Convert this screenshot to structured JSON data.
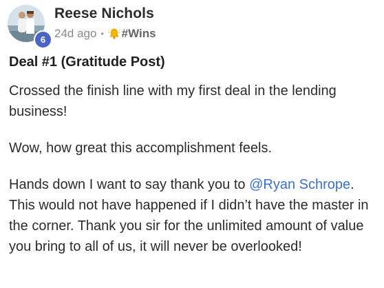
{
  "post": {
    "author": {
      "name": "Reese Nichols",
      "level": "6"
    },
    "time_ago": "24d ago",
    "separator": "•",
    "category": "#Wins",
    "title": "Deal #1 (Gratitude Post)",
    "paragraphs": {
      "p1": "Crossed the finish line with my first deal in the lending business!",
      "p2": "Wow, how great this accomplishment feels.",
      "p3_before": "Hands down I want to say thank you to ",
      "p3_mention": "@Ryan Schrope",
      "p3_after": ". This would not have happened if I didn’t have the master in the corner. Thank you sir for the unlimited amount of value you bring to all of us, it will never be overlooked!"
    }
  },
  "icons": {
    "category_icon": "bell-icon"
  },
  "colors": {
    "mention": "#3b6fd0",
    "level_badge": "#4a64c8"
  }
}
